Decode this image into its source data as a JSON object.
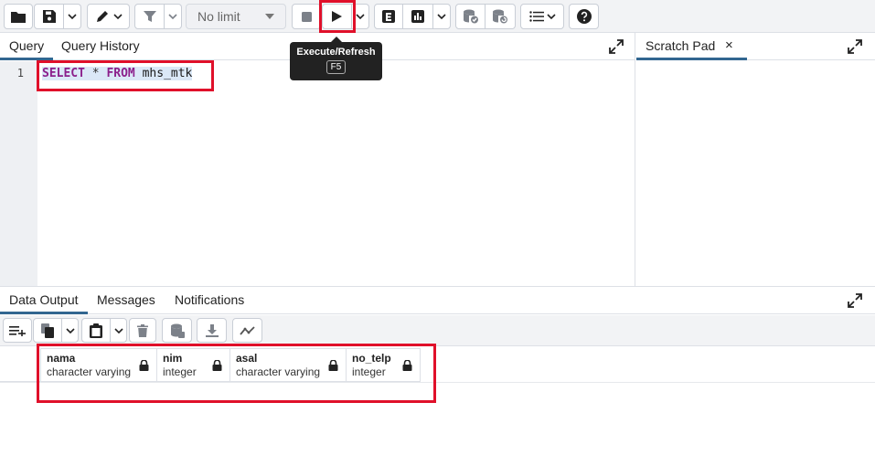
{
  "toolbar": {
    "limit_value": "No limit",
    "tooltip": {
      "title": "Execute/Refresh",
      "shortcut": "F5"
    }
  },
  "query_tabs": {
    "query": "Query",
    "history": "Query History"
  },
  "editor": {
    "line_number": "1",
    "kw_select": "SELECT",
    "op_star": " * ",
    "kw_from": "FROM",
    "table": " mhs_mtk"
  },
  "scratch": {
    "tab": "Scratch Pad",
    "close": "×"
  },
  "output_tabs": {
    "data_output": "Data Output",
    "messages": "Messages",
    "notifications": "Notifications"
  },
  "grid": {
    "columns": [
      {
        "name": "nama",
        "type": "character varying"
      },
      {
        "name": "nim",
        "type": "integer"
      },
      {
        "name": "asal",
        "type": "character varying"
      },
      {
        "name": "no_telp",
        "type": "integer"
      }
    ]
  },
  "colors": {
    "accent": "#326690",
    "highlight": "#e0102a",
    "keyword": "#8b1f8b"
  }
}
